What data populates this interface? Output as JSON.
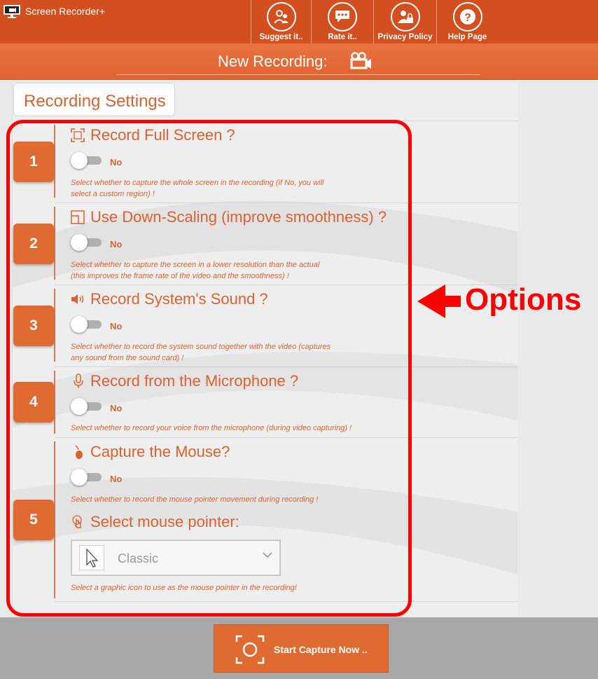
{
  "app": {
    "title": "Screen Recorder+"
  },
  "toolbar": {
    "buttons": [
      {
        "label": "Suggest it..",
        "icon": "users-icon"
      },
      {
        "label": "Rate it..",
        "icon": "comment-icon"
      },
      {
        "label": "Privacy Policy",
        "icon": "user-lock-icon"
      },
      {
        "label": "Help Page",
        "icon": "help-icon"
      }
    ]
  },
  "header": {
    "title": "New Recording:",
    "icon": "video-camera-icon"
  },
  "settings": {
    "tab_label": "Recording Settings",
    "options": [
      {
        "number": "1",
        "title": "Record Full Screen ?",
        "icon": "fullscreen-icon",
        "state": "No",
        "desc_line1": "Select whether to capture the whole screen in the recording (if No, you will",
        "desc_line2": "select a custom region) !"
      },
      {
        "number": "2",
        "title": "Use Down-Scaling (improve smoothness) ?",
        "icon": "downscale-icon",
        "state": "No",
        "desc_line1": "Select whether to capture the screen in a lower resolution than the actual",
        "desc_line2": "(this improves the frame rate of the video and the smoothness) !"
      },
      {
        "number": "3",
        "title": "Record System's Sound ?",
        "icon": "speaker-icon",
        "state": "No",
        "desc_line1": "Select whether to record the system sound together with the video (captures",
        "desc_line2": "any sound from the sound card) !"
      },
      {
        "number": "4",
        "title": "Record from the Microphone ?",
        "icon": "microphone-icon",
        "state": "No",
        "desc_line1": "Select whether to record your voice from the microphone (during video capturing) !"
      },
      {
        "number": "5",
        "title": "Capture the Mouse?",
        "icon": "mouse-icon",
        "state": "No",
        "desc_line1": "Select whether to record the mouse pointer movement during recording !"
      }
    ],
    "pointer": {
      "title": "Select mouse pointer:",
      "dash": "-",
      "selected": "Classic",
      "desc": "Select a graphic icon to use as the mouse pointer in the recording!"
    }
  },
  "annotation": {
    "label": "Options",
    "color": "#ff0000"
  },
  "footer": {
    "start_label": "Start Capture Now .."
  },
  "colors": {
    "accent": "#df6a32",
    "topbar": "#d44f1f",
    "text": "#d86231"
  }
}
